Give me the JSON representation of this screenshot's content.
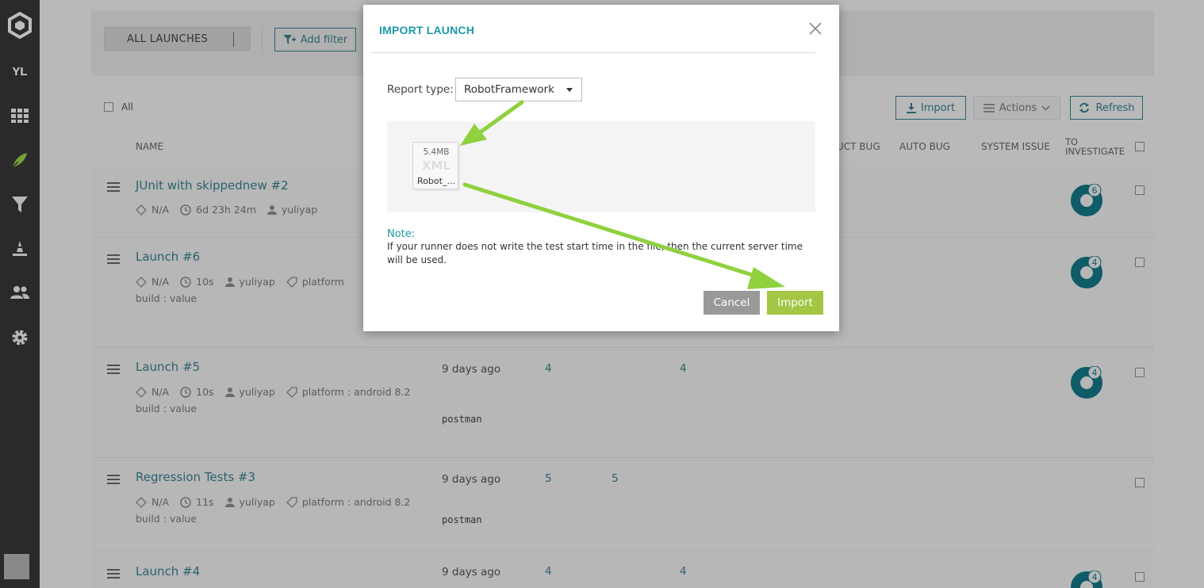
{
  "sidebar": {
    "user_initials": "YL",
    "items": [
      "logo-icon",
      "dashboard-icon",
      "launches-icon",
      "filters-icon",
      "debug-icon",
      "members-icon",
      "settings-icon"
    ]
  },
  "filter_bar": {
    "all_launches": "ALL LAUNCHES",
    "add_filter": "Add filter"
  },
  "toolbar": {
    "all_label": "All",
    "import_label": "Import",
    "actions_label": "Actions",
    "refresh_label": "Refresh"
  },
  "columns": {
    "name": "NAME",
    "product_bug": "UCT BUG",
    "auto_bug": "AUTO BUG",
    "system_issue": "SYSTEM ISSUE",
    "to_investigate_1": "TO",
    "to_investigate_2": "INVESTIGATE"
  },
  "launches": [
    {
      "title": "JUnit with skippednew #2",
      "na": "N/A",
      "duration": "6d 23h 24m",
      "owner": "yuliyap",
      "platform": "",
      "attr": "",
      "time": "",
      "stat1": "",
      "stat2": "",
      "desc": "",
      "to_investigate": "6"
    },
    {
      "title": "Launch #6",
      "na": "N/A",
      "duration": "10s",
      "owner": "yuliyap",
      "platform": "platform",
      "attr": "build : value",
      "time": "",
      "stat1": "",
      "stat2": "",
      "desc": "",
      "to_investigate": "4"
    },
    {
      "title": "Launch #5",
      "na": "N/A",
      "duration": "10s",
      "owner": "yuliyap",
      "platform": "platform : android 8.2",
      "attr": "build : value",
      "time": "9 days ago",
      "stat1": "4",
      "stat2": "4",
      "desc": "postman",
      "to_investigate": "4"
    },
    {
      "title": "Regression Tests #3",
      "na": "N/A",
      "duration": "11s",
      "owner": "yuliyap",
      "platform": "platform : android 8.2",
      "attr": "build : value",
      "time": "9 days ago",
      "stat1": "5",
      "stat2": "5",
      "desc": "postman",
      "to_investigate": ""
    },
    {
      "title": "Launch #4",
      "na": "",
      "duration": "",
      "owner": "",
      "platform": "",
      "attr": "",
      "time": "9 days ago",
      "stat1": "4",
      "stat2": "4",
      "desc": "",
      "to_investigate": "4"
    }
  ],
  "modal": {
    "title": "IMPORT LAUNCH",
    "report_type_label": "Report type:",
    "report_type_value": "RobotFramework",
    "file_size": "5.4MB",
    "file_ext": "XML",
    "file_name": "Robot_...",
    "note_label": "Note:",
    "note_text": "If your runner does not write the test start time in the file, then the current server time will be used.",
    "cancel_label": "Cancel",
    "import_label": "Import"
  },
  "colors": {
    "accent": "#1c9aa7",
    "import_green": "#a3c644",
    "arrow_green": "#8fd13f",
    "donut": "#0b6474"
  }
}
